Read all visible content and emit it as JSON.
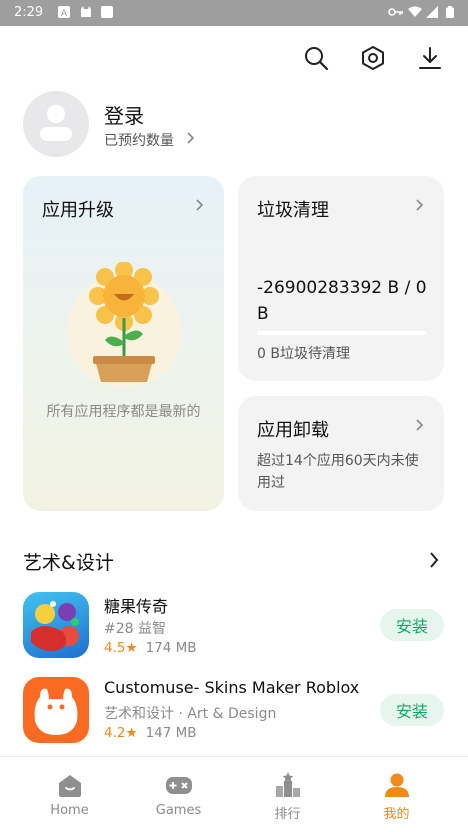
{
  "status_bar": {
    "time": "2:29"
  },
  "profile": {
    "login_label": "登录",
    "reserve_label": "已预约数量"
  },
  "cards": {
    "upgrade": {
      "title": "应用升级",
      "status": "所有应用程序都是最新的"
    },
    "junk": {
      "title": "垃圾清理",
      "size_text": "-26900283392 B / 0 B",
      "pending_text": "0 B垃圾待清理"
    },
    "uninstall": {
      "title": "应用卸载",
      "desc": "超过14个应用60天内未使用过"
    }
  },
  "section": {
    "title": "艺术&设计"
  },
  "apps": [
    {
      "name": "糖果传奇",
      "meta": "#28 益智",
      "rating": "4.5★",
      "size": "174 MB",
      "button": "安装"
    },
    {
      "name": "Customuse- Skins Maker Roblox",
      "meta": "艺术和设计 · Art & Design",
      "rating": "4.2★",
      "size": "147 MB",
      "button": "安装"
    }
  ],
  "bottom_nav": [
    {
      "label": "Home",
      "icon": "home-icon",
      "active": false
    },
    {
      "label": "Games",
      "icon": "gamepad-icon",
      "active": false
    },
    {
      "label": "排行",
      "icon": "ranking-icon",
      "active": false
    },
    {
      "label": "我的",
      "icon": "person-icon",
      "active": true
    }
  ],
  "colors": {
    "accent": "#f08a1c",
    "install_green": "#13a86b",
    "status_bar": "#9e9e9e"
  }
}
